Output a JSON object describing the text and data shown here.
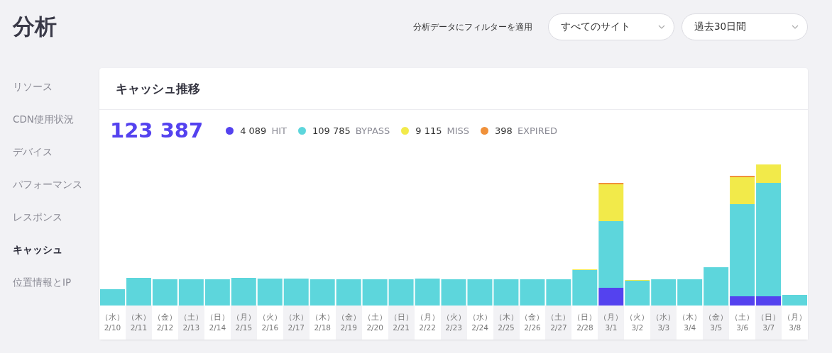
{
  "page_title": "分析",
  "filter": {
    "label": "分析データにフィルターを適用",
    "selects": [
      {
        "value": "すべてのサイト"
      },
      {
        "value": "過去30日間"
      }
    ]
  },
  "sidebar": {
    "items": [
      {
        "label": "リソース",
        "selected": false
      },
      {
        "label": "CDN使用状況",
        "selected": false
      },
      {
        "label": "デバイス",
        "selected": false
      },
      {
        "label": "パフォーマンス",
        "selected": false
      },
      {
        "label": "レスポンス",
        "selected": false
      },
      {
        "label": "キャッシュ",
        "selected": true
      },
      {
        "label": "位置情報とIP",
        "selected": false
      }
    ]
  },
  "card": {
    "title": "キャッシュ推移",
    "total": "123 387",
    "legend": [
      {
        "value": "4 089",
        "label": "HIT",
        "color": "#5442ef"
      },
      {
        "value": "109 785",
        "label": "BYPASS",
        "color": "#5dd6dc"
      },
      {
        "value": "9 115",
        "label": "MISS",
        "color": "#f2ea4a"
      },
      {
        "value": "398",
        "label": "EXPIRED",
        "color": "#f0913a"
      }
    ],
    "x_labels": [
      {
        "weekday": "（水）",
        "date": "2/10"
      },
      {
        "weekday": "（木）",
        "date": "2/11"
      },
      {
        "weekday": "（金）",
        "date": "2/12"
      },
      {
        "weekday": "（土）",
        "date": "2/13"
      },
      {
        "weekday": "（日）",
        "date": "2/14"
      },
      {
        "weekday": "（月）",
        "date": "2/15"
      },
      {
        "weekday": "（火）",
        "date": "2/16"
      },
      {
        "weekday": "（水）",
        "date": "2/17"
      },
      {
        "weekday": "（木）",
        "date": "2/18"
      },
      {
        "weekday": "（金）",
        "date": "2/19"
      },
      {
        "weekday": "（土）",
        "date": "2/20"
      },
      {
        "weekday": "（日）",
        "date": "2/21"
      },
      {
        "weekday": "（月）",
        "date": "2/22"
      },
      {
        "weekday": "（火）",
        "date": "2/23"
      },
      {
        "weekday": "（水）",
        "date": "2/24"
      },
      {
        "weekday": "（木）",
        "date": "2/25"
      },
      {
        "weekday": "（金）",
        "date": "2/26"
      },
      {
        "weekday": "（土）",
        "date": "2/27"
      },
      {
        "weekday": "（日）",
        "date": "2/28"
      },
      {
        "weekday": "（月）",
        "date": "3/1"
      },
      {
        "weekday": "（火）",
        "date": "3/2"
      },
      {
        "weekday": "（水）",
        "date": "3/3"
      },
      {
        "weekday": "（木）",
        "date": "3/4"
      },
      {
        "weekday": "（金）",
        "date": "3/5"
      },
      {
        "weekday": "（土）",
        "date": "3/6"
      },
      {
        "weekday": "（日）",
        "date": "3/7"
      },
      {
        "weekday": "（月）",
        "date": "3/8"
      }
    ]
  }
}
